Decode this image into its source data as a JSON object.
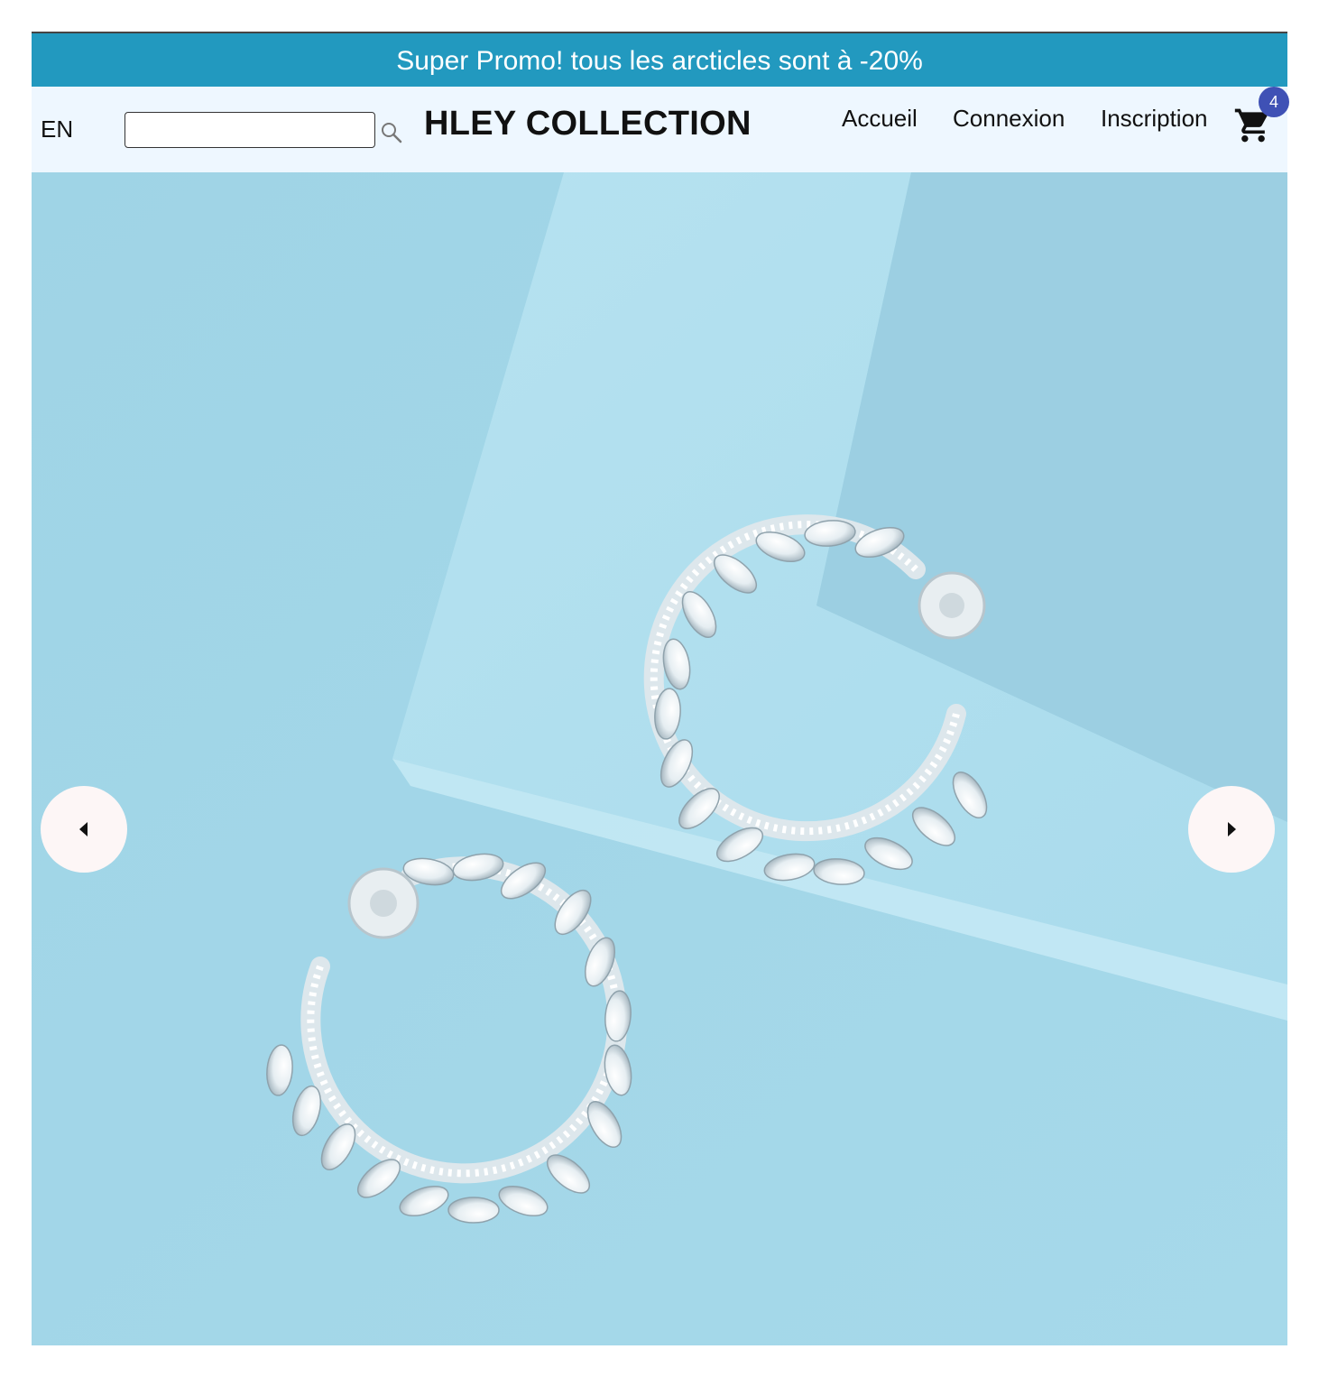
{
  "promo": {
    "text": "Super Promo! tous les arcticles sont à -20%"
  },
  "header": {
    "language": "EN",
    "search": {
      "value": "",
      "placeholder": ""
    },
    "brand": "HLEY COLLECTION",
    "nav": [
      {
        "label": "Accueil"
      },
      {
        "label": "Connexion"
      },
      {
        "label": "Inscription"
      }
    ],
    "cart": {
      "count": "4",
      "icon": "shopping-cart-icon"
    }
  },
  "carousel": {
    "image": "silver hoop earrings with marquise stones on light blue paper",
    "prev_icon": "arrow-left-icon",
    "next_icon": "arrow-right-icon"
  },
  "colors": {
    "promo_bg": "#2299bf",
    "nav_bg": "#eef7ff",
    "badge_bg": "#3f51b5",
    "hero_bg": "#9fd6e8"
  }
}
